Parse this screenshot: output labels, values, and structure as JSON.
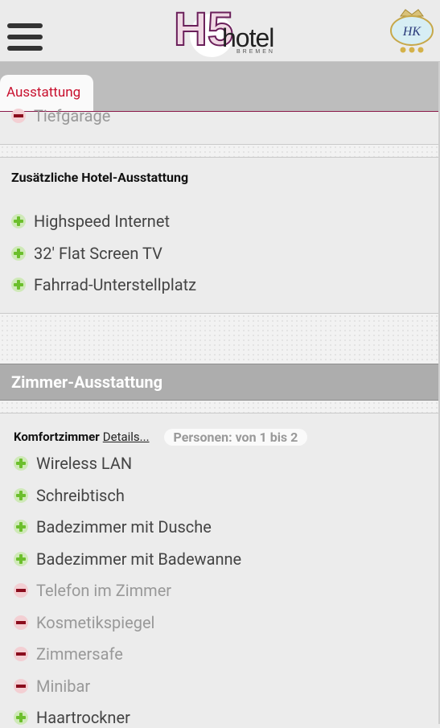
{
  "header": {
    "logo_h5": "H5",
    "logo_text": "hotel",
    "logo_sub": "BREMEN",
    "crest_letters": "HK"
  },
  "tab": {
    "label": "Ausstattung"
  },
  "facilities": {
    "partial_item": {
      "label": "Tiefgarage",
      "status": "unavailable"
    },
    "additional_title": "Zusätzliche Hotel-Ausstattung",
    "additional_items": [
      {
        "label": "Highspeed Internet",
        "status": "available"
      },
      {
        "label": "32' Flat Screen TV",
        "status": "available"
      },
      {
        "label": "Fahrrad-Unterstellplatz",
        "status": "available"
      }
    ]
  },
  "rooms": {
    "heading": "Zimmer-Ausstattung",
    "room_name": "Komfortzimmer",
    "details_link": "Details...",
    "persons": "Personen: von 1 bis 2",
    "items": [
      {
        "label": "Wireless LAN",
        "status": "available"
      },
      {
        "label": "Schreibtisch",
        "status": "available"
      },
      {
        "label": "Badezimmer mit Dusche",
        "status": "available"
      },
      {
        "label": "Badezimmer mit Badewanne",
        "status": "available"
      },
      {
        "label": "Telefon im Zimmer",
        "status": "unavailable"
      },
      {
        "label": "Kosmetikspiegel",
        "status": "unavailable"
      },
      {
        "label": "Zimmersafe",
        "status": "unavailable"
      },
      {
        "label": "Minibar",
        "status": "unavailable"
      },
      {
        "label": "Haartrockner",
        "status": "available"
      }
    ]
  },
  "colors": {
    "accent": "#c8102e",
    "brand_purple": "#7a2a6a",
    "available_icon": "#6cbf2c",
    "unavailable_icon": "#8b0d1d"
  }
}
